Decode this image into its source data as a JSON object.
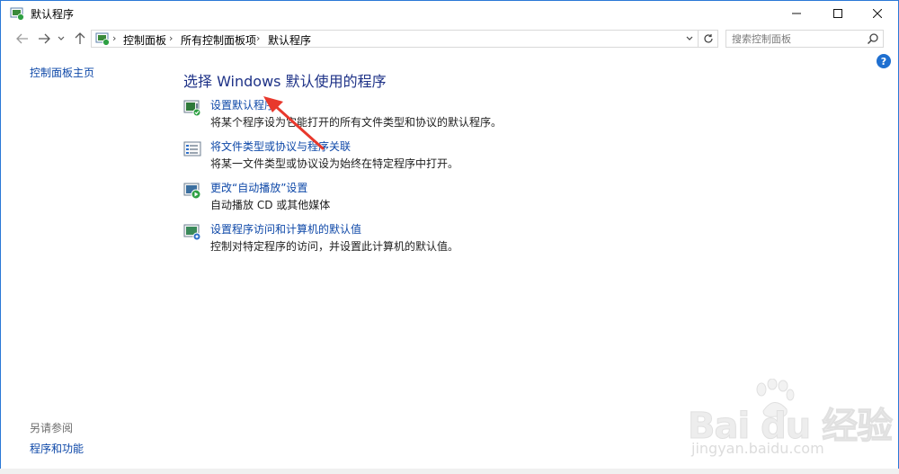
{
  "window": {
    "title": "默认程序"
  },
  "nav": {
    "breadcrumbs": [
      "控制面板",
      "所有控制面板项",
      "默认程序"
    ],
    "search_placeholder": "搜索控制面板"
  },
  "left_pane": {
    "home_link": "控制面板主页",
    "see_also_heading": "另请参阅",
    "see_also_link": "程序和功能"
  },
  "main": {
    "title": "选择 Windows 默认使用的程序",
    "tasks": [
      {
        "icon": "default-programs-icon",
        "label": "设置默认程序",
        "desc": "将某个程序设为它能打开的所有文件类型和协议的默认程序。"
      },
      {
        "icon": "file-association-icon",
        "label": "将文件类型或协议与程序关联",
        "desc": "将某一文件类型或协议设为始终在特定程序中打开。"
      },
      {
        "icon": "autoplay-icon",
        "label": "更改“自动播放”设置",
        "desc": "自动播放 CD 或其他媒体"
      },
      {
        "icon": "program-access-icon",
        "label": "设置程序访问和计算机的默认值",
        "desc": "控制对特定程序的访问，并设置此计算机的默认值。"
      }
    ]
  },
  "watermark": {
    "brand": "Bai du 经验",
    "url": "jingyan.baidu.com"
  },
  "colors": {
    "link": "#0e48a8",
    "title": "#1e3287",
    "window_border": "#2b79d7",
    "annotation_arrow": "#e8382c"
  }
}
